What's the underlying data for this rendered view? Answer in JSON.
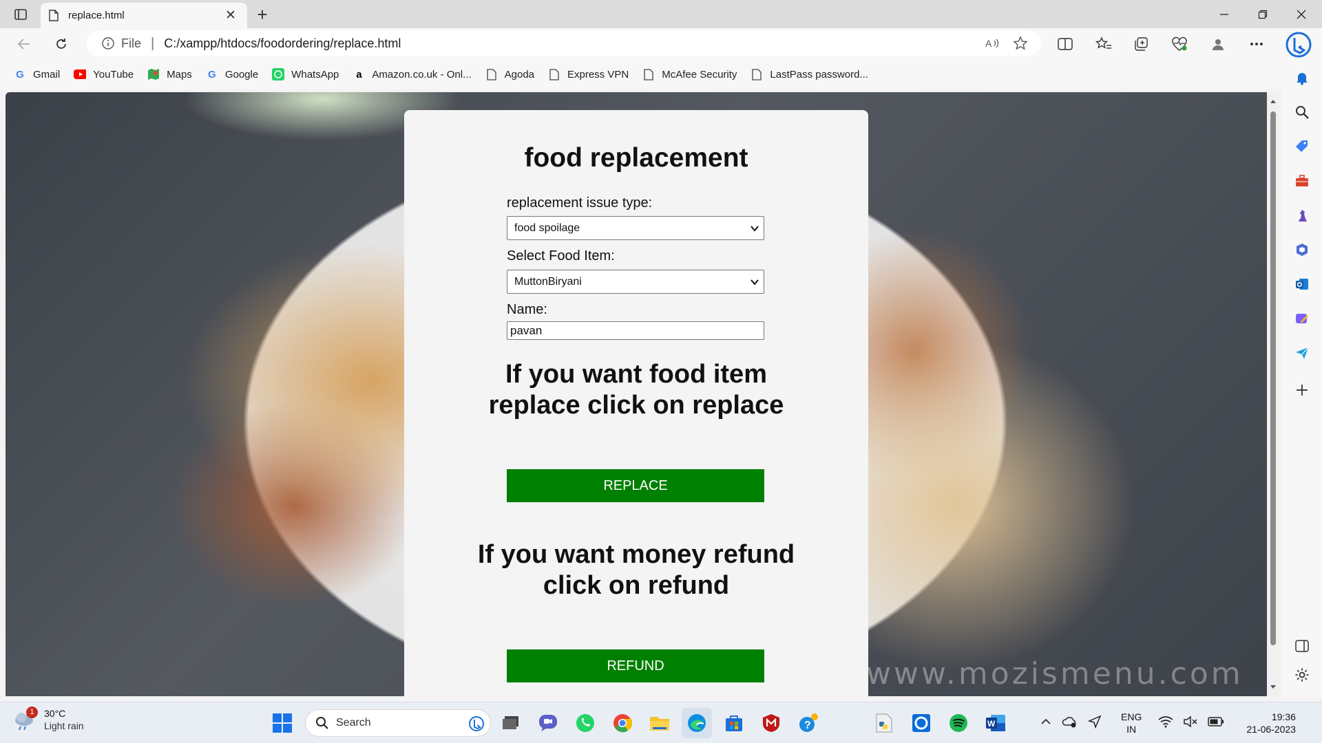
{
  "browser": {
    "tab_title": "replace.html",
    "url_scheme": "File",
    "url": "C:/xampp/htdocs/foodordering/replace.html"
  },
  "favorites": [
    {
      "label": "Gmail",
      "icon": "google-icon",
      "color": "#4285f4"
    },
    {
      "label": "YouTube",
      "icon": "youtube-icon",
      "color": "#ff0000"
    },
    {
      "label": "Maps",
      "icon": "maps-icon",
      "color": "#34a853"
    },
    {
      "label": "Google",
      "icon": "google-icon",
      "color": "#4285f4"
    },
    {
      "label": "WhatsApp",
      "icon": "whatsapp-icon",
      "color": "#25d366"
    },
    {
      "label": "Amazon.co.uk - Onl...",
      "icon": "amazon-icon",
      "color": "#000000"
    },
    {
      "label": "Agoda",
      "icon": "page-icon",
      "color": "#555555"
    },
    {
      "label": "Express VPN",
      "icon": "page-icon",
      "color": "#555555"
    },
    {
      "label": "McAfee Security",
      "icon": "page-icon",
      "color": "#555555"
    },
    {
      "label": "LastPass password...",
      "icon": "page-icon",
      "color": "#555555"
    }
  ],
  "page": {
    "title": "food replacement",
    "issue_label": "replacement issue type:",
    "issue_value": "food spoilage",
    "food_label": "Select Food Item:",
    "food_value": "MuttonBiryani",
    "name_label": "Name:",
    "name_value": "pavan",
    "replace_prompt": "If you want food item replace click on replace",
    "replace_button": "REPLACE",
    "refund_prompt": "If you want money refund click on refund",
    "refund_button": "REFUND",
    "watermark": "www.mozismenu.com",
    "button_color": "#008000"
  },
  "taskbar": {
    "weather_temp": "30°C",
    "weather_desc": "Light rain",
    "weather_badge": "1",
    "search_placeholder": "Search",
    "lang_top": "ENG",
    "lang_bottom": "IN",
    "time": "19:36",
    "date": "21-06-2023"
  }
}
